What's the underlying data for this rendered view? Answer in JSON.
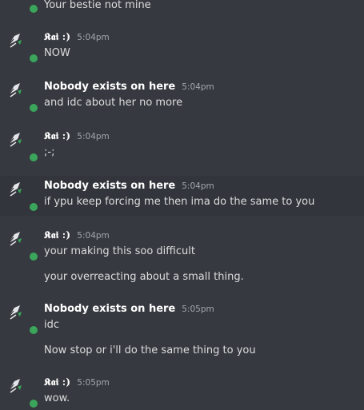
{
  "colors": {
    "background": "#36393f",
    "highlight_row": "#32353b",
    "online_status": "#3ba55c",
    "author_text": "#ffffff",
    "message_text": "#dcddde",
    "timestamp_text": "#a3a6aa"
  },
  "messages": [
    {
      "text": "Your bestie not mine"
    },
    {
      "author": "𝕶𝖆𝖎 :)",
      "time": "5:04pm",
      "text": "NOW"
    },
    {
      "author": "Nobody exists on here",
      "time": "5:04pm",
      "text": "and idc about her no more"
    },
    {
      "author": "𝕶𝖆𝖎 :)",
      "time": "5:04pm",
      "text": ";-;"
    },
    {
      "author": "Nobody exists on here",
      "time": "5:04pm",
      "text": "if ypu keep forcing me then ima do the same to you"
    },
    {
      "author": "𝕶𝖆𝖎 :)",
      "time": "5:04pm",
      "text": "your making this soo difficult",
      "followup": "your overreacting about a small thing."
    },
    {
      "author": "Nobody exists on here",
      "time": "5:05pm",
      "text": "idc",
      "followup": "Now stop or i'll do the same thing to you"
    },
    {
      "author": "𝕶𝖆𝖎 :)",
      "time": "5:05pm",
      "text": "wow."
    }
  ]
}
